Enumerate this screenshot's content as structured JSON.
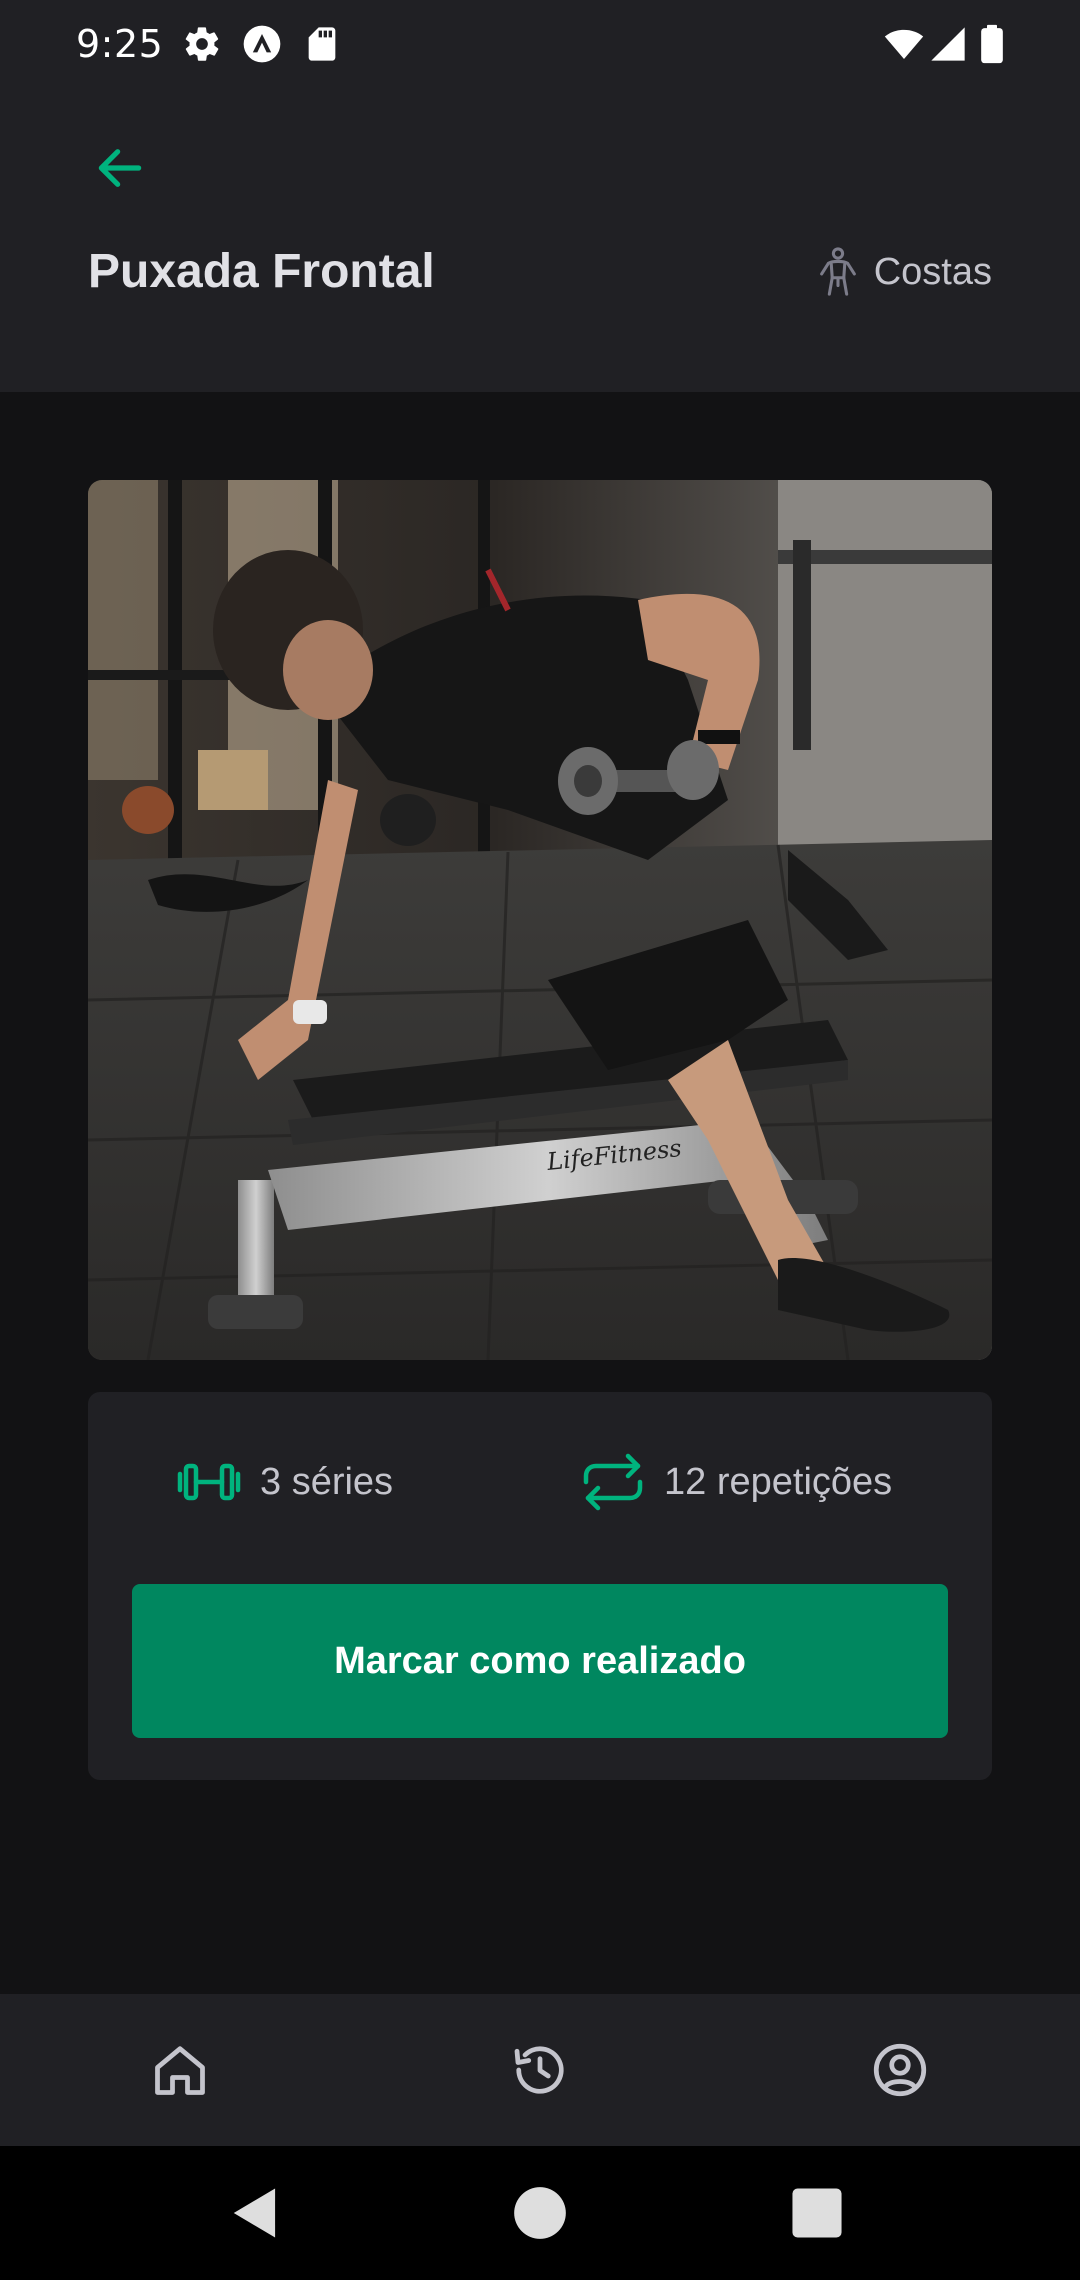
{
  "status_bar": {
    "time": "9:25",
    "icons": [
      "settings-gear-icon",
      "app-notification-icon",
      "sd-card-icon",
      "wifi-icon",
      "signal-icon",
      "battery-icon"
    ]
  },
  "header": {
    "back_icon": "arrow-left-icon",
    "title": "Puxada Frontal",
    "group_icon": "body-icon",
    "group_label": "Costas"
  },
  "exercise": {
    "image": "photo of man performing one-arm dumbbell row on a gym bench",
    "bench_brand": "LifeFitness",
    "series_icon": "dumbbell-icon",
    "series_label": "3 séries",
    "reps_icon": "repeat-icon",
    "reps_label": "12 repetições",
    "done_button_label": "Marcar como realizado"
  },
  "tab_bar": {
    "tabs": [
      {
        "name": "home",
        "icon": "home-icon"
      },
      {
        "name": "history",
        "icon": "history-icon"
      },
      {
        "name": "profile",
        "icon": "user-circle-icon"
      }
    ]
  },
  "colors": {
    "background": "#121214",
    "surface": "#202024",
    "accent": "#00875F",
    "accent_icon": "#00B37E",
    "text_primary": "#E1E1E6",
    "text_secondary": "#C4C4CC"
  }
}
